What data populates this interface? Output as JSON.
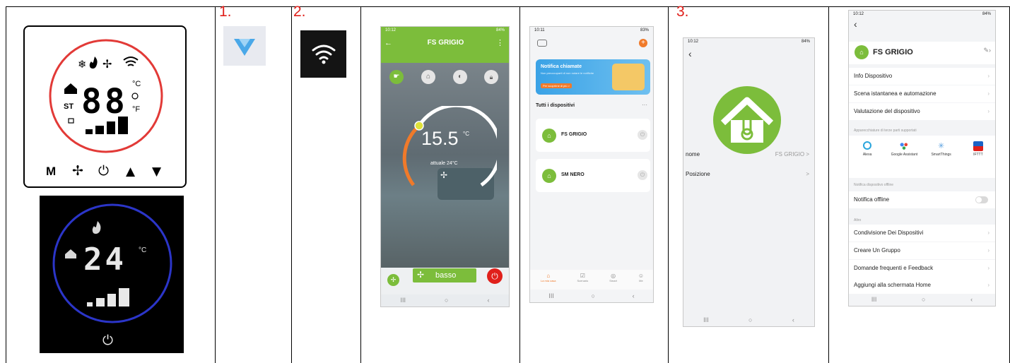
{
  "steps": {
    "one": "1.",
    "two": "2.",
    "three": "3."
  },
  "thermostat": {
    "white": {
      "digits": "88",
      "celsius": "°C",
      "fahrenheit": "°F",
      "st": "ST",
      "buttons": [
        "M",
        "✢",
        "⏻",
        "▲",
        "▼"
      ]
    },
    "black": {
      "digits": "24",
      "celsius": "°C"
    }
  },
  "screen_control": {
    "status_time": "10:12",
    "status_right": "84%",
    "title": "FS GRIGIO",
    "temperature": "15.5",
    "temp_unit": "°C",
    "actual": "attuale 24°C",
    "fan_label": "basso"
  },
  "screen_home": {
    "status_time": "10:11",
    "status_right": "83%",
    "banner_title": "Notifica chiamate",
    "banner_sub": "Non preoccuparti di non notare le notifiche",
    "banner_button": "Per scoprirne di più >",
    "section_title": "Tutti i dispositivi",
    "section_more": "···",
    "devices": [
      {
        "name": "FS GRIGIO"
      },
      {
        "name": "SM NERO"
      }
    ],
    "tabs": [
      "La mia casa",
      "Scenario",
      "Smart",
      "Me"
    ]
  },
  "screen_device": {
    "status_time": "10:12",
    "status_right": "84%",
    "rows": [
      {
        "label": "nome",
        "value": "FS GRIGIO >"
      },
      {
        "label": "Posizione",
        "value": ">"
      }
    ]
  },
  "screen_settings": {
    "status_time": "10:12",
    "status_right": "84%",
    "title": "FS GRIGIO",
    "rows_top": [
      "Info Dispositivo",
      "Scena istantanea e automazione",
      "Valutazione del dispositivo"
    ],
    "third_party_header": "Apparecchiature di terze parti supportati",
    "third_party": [
      "Alexa",
      "Google Assistant",
      "SmartThings",
      "IFTTT"
    ],
    "offline_header": "Notifica dispositivo offline",
    "offline_row": "Notifica offline",
    "other_header": "Altro",
    "rows_bottom": [
      "Condivisione Dei Dispositivi",
      "Creare Un Gruppo",
      "Domande frequenti e Feedback",
      "Aggiungi alla schermata Home"
    ]
  },
  "colors": {
    "accent_green": "#7cbd3b",
    "accent_red": "#e0201b",
    "accent_orange": "#f07a2a",
    "black_ring": "#2b35c8"
  },
  "icons": [
    "snowflake-icon",
    "flame-icon",
    "fan-icon",
    "wifi-icon",
    "home-icon",
    "clock-icon",
    "lock-icon",
    "signal-bars-icon",
    "power-icon",
    "smartconfig-arrow-icon",
    "thermometer-house-icon",
    "chevron-left-icon",
    "chevron-right-icon"
  ]
}
